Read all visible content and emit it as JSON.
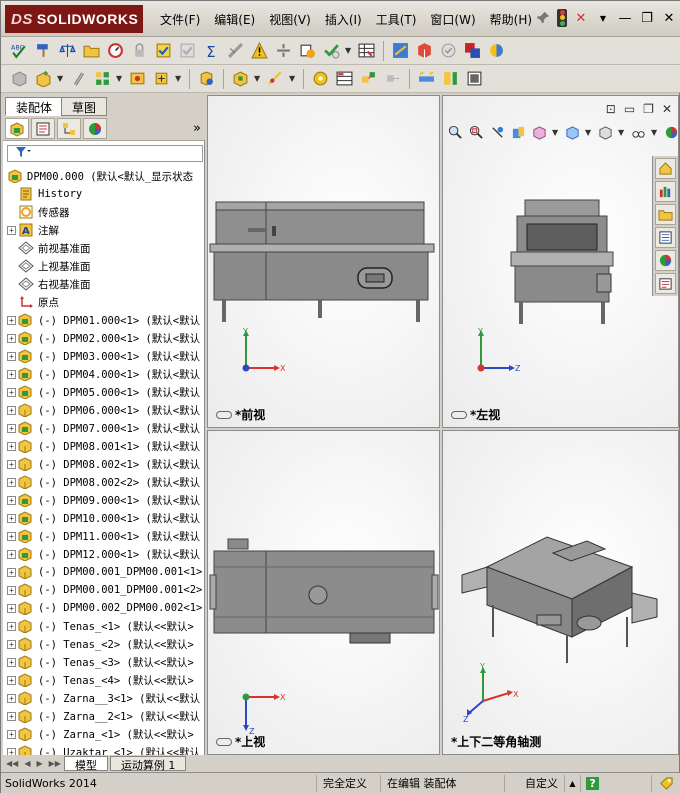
{
  "app": {
    "brand": "SOLIDWORKS",
    "brand_prefix": "DS"
  },
  "menu": [
    "文件(F)",
    "编辑(E)",
    "视图(V)",
    "插入(I)",
    "工具(T)",
    "窗口(W)",
    "帮助(H)"
  ],
  "left_panel": {
    "tabs": [
      "装配体",
      "草图"
    ],
    "active_tab": "装配体",
    "more_glyph": "»",
    "tree": [
      {
        "label": "DPM00.000  (默认<默认_显示状态",
        "icon": "assembly-icon",
        "expand": "none",
        "root": true
      },
      {
        "label": "History",
        "icon": "history-icon",
        "expand": "none"
      },
      {
        "label": "传感器",
        "icon": "sensor-icon",
        "expand": "none"
      },
      {
        "label": "注解",
        "icon": "annotation-icon",
        "expand": "+"
      },
      {
        "label": "前视基准面",
        "icon": "plane-icon",
        "expand": "none"
      },
      {
        "label": "上视基准面",
        "icon": "plane-icon",
        "expand": "none"
      },
      {
        "label": "右视基准面",
        "icon": "plane-icon",
        "expand": "none"
      },
      {
        "label": "原点",
        "icon": "origin-icon",
        "expand": "none"
      },
      {
        "label": "(-) DPM01.000<1> (默认<默认",
        "icon": "subassembly-icon",
        "expand": "+"
      },
      {
        "label": "(-) DPM02.000<1> (默认<默认",
        "icon": "subassembly-icon",
        "expand": "+"
      },
      {
        "label": "(-) DPM03.000<1> (默认<默认",
        "icon": "subassembly-icon",
        "expand": "+"
      },
      {
        "label": "(-) DPM04.000<1> (默认<默认",
        "icon": "subassembly-icon",
        "expand": "+"
      },
      {
        "label": "(-) DPM05.000<1> (默认<默认",
        "icon": "subassembly-icon",
        "expand": "+"
      },
      {
        "label": "(-) DPM06.000<1> (默认<默认",
        "icon": "part-icon",
        "expand": "+"
      },
      {
        "label": "(-) DPM07.000<1> (默认<默认",
        "icon": "subassembly-icon",
        "expand": "+"
      },
      {
        "label": "(-) DPM08.001<1> (默认<默认",
        "icon": "part-icon",
        "expand": "+"
      },
      {
        "label": "(-) DPM08.002<1> (默认<默认",
        "icon": "part-icon",
        "expand": "+"
      },
      {
        "label": "(-) DPM08.002<2> (默认<默认",
        "icon": "part-icon",
        "expand": "+"
      },
      {
        "label": "(-) DPM09.000<1> (默认<默认",
        "icon": "subassembly-icon",
        "expand": "+"
      },
      {
        "label": "(-) DPM10.000<1> (默认<默认",
        "icon": "subassembly-icon",
        "expand": "+"
      },
      {
        "label": "(-) DPM11.000<1> (默认<默认",
        "icon": "subassembly-icon",
        "expand": "+"
      },
      {
        "label": "(-) DPM12.000<1> (默认<默认",
        "icon": "subassembly-icon",
        "expand": "+"
      },
      {
        "label": "(-) DPM00.001_DPM00.001<1>",
        "icon": "part-icon",
        "expand": "+"
      },
      {
        "label": "(-) DPM00.001_DPM00.001<2>",
        "icon": "part-icon",
        "expand": "+"
      },
      {
        "label": "(-) DPM00.002_DPM00.002<1>",
        "icon": "part-icon",
        "expand": "+"
      },
      {
        "label": "(-) Tenas_<1> (默认<<默认>",
        "icon": "part-icon",
        "expand": "+"
      },
      {
        "label": "(-) Tenas_<2> (默认<<默认>",
        "icon": "part-icon",
        "expand": "+"
      },
      {
        "label": "(-) Tenas_<3> (默认<<默认>",
        "icon": "part-icon",
        "expand": "+"
      },
      {
        "label": "(-) Tenas_<4> (默认<<默认>",
        "icon": "part-icon",
        "expand": "+"
      },
      {
        "label": "(-) Zarna__3<1> (默认<<默认",
        "icon": "part-icon",
        "expand": "+"
      },
      {
        "label": "(-) Zarna__2<1> (默认<<默认",
        "icon": "part-icon",
        "expand": "+"
      },
      {
        "label": "(-) Zarna_<1> (默认<<默认>",
        "icon": "part-icon",
        "expand": "+"
      },
      {
        "label": "(-) Uzaktar <1> (默认<<默认",
        "icon": "part-icon",
        "expand": "+"
      }
    ]
  },
  "viewports": {
    "front": {
      "label": "*前视",
      "axes": [
        "X",
        "Y"
      ]
    },
    "left": {
      "label": "*左视",
      "axes": [
        "Z",
        "Y"
      ]
    },
    "top": {
      "label": "*上视",
      "axes": [
        "X",
        "Z"
      ]
    },
    "iso": {
      "label": "*上下二等角轴测",
      "axes": [
        "X",
        "Y",
        "Z"
      ]
    }
  },
  "bottom_tabs": [
    "模型",
    "运动算例 1"
  ],
  "status": {
    "app_name": "SolidWorks 2014",
    "definition": "完全定义",
    "editing": "在编辑 装配体",
    "units": "自定义",
    "help": "?"
  },
  "colors": {
    "brand_red": "#7d1713",
    "model_gray": "#8a8a8a",
    "axis_x": "#d9332b",
    "axis_y": "#2e9a3c",
    "axis_z": "#2e47c4"
  }
}
